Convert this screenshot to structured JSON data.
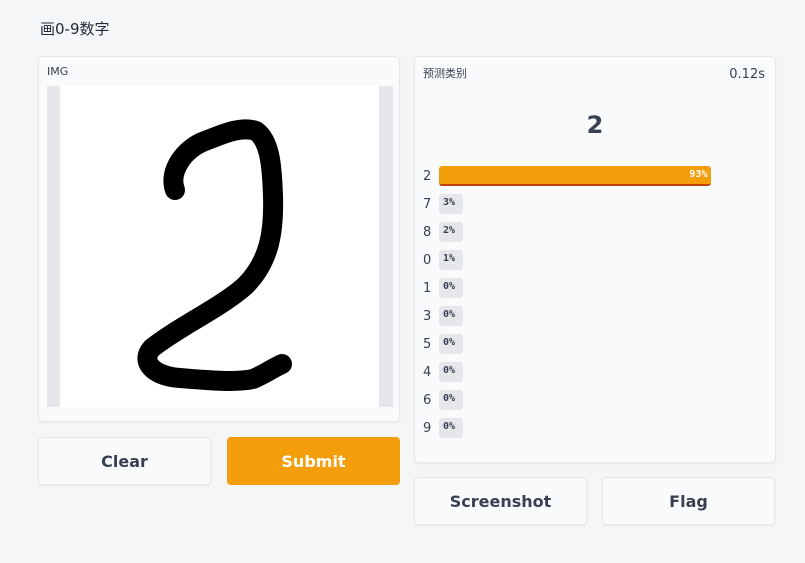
{
  "page": {
    "title": "画0-9数字"
  },
  "input_panel": {
    "label": "IMG"
  },
  "buttons": {
    "clear": "Clear",
    "submit": "Submit",
    "screenshot": "Screenshot",
    "flag": "Flag"
  },
  "output_panel": {
    "label": "预测类别",
    "time": "0.12s",
    "top_prediction": "2",
    "predictions": [
      {
        "label": "2",
        "percent_text": "93%",
        "fraction": 0.93
      },
      {
        "label": "7",
        "percent_text": "3%",
        "fraction": 0.03
      },
      {
        "label": "8",
        "percent_text": "2%",
        "fraction": 0.02
      },
      {
        "label": "0",
        "percent_text": "1%",
        "fraction": 0.01
      },
      {
        "label": "1",
        "percent_text": "0%",
        "fraction": 0.0
      },
      {
        "label": "3",
        "percent_text": "0%",
        "fraction": 0.0
      },
      {
        "label": "5",
        "percent_text": "0%",
        "fraction": 0.0
      },
      {
        "label": "4",
        "percent_text": "0%",
        "fraction": 0.0
      },
      {
        "label": "6",
        "percent_text": "0%",
        "fraction": 0.0
      },
      {
        "label": "9",
        "percent_text": "0%",
        "fraction": 0.0
      }
    ]
  },
  "colors": {
    "accent": "#f59e0b",
    "accent_border": "#c2410c",
    "panel_bg": "#f9fafb",
    "page_bg": "#f5f6f8"
  }
}
